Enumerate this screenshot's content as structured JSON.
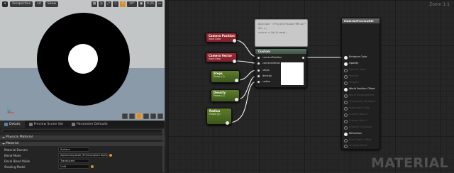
{
  "viewport": {
    "toolbar": {
      "menu_icon": "chevron-down-icon",
      "perspective_label": "Perspective",
      "lit_label": "Lit",
      "show_label": "Show",
      "right_buttons": [
        "▦",
        "◎",
        "⤢",
        "◇",
        "8",
        "10°",
        "▣",
        "0.25",
        "▭"
      ]
    },
    "preview_icons": [
      "cylinder-icon",
      "sphere-icon",
      "plane-icon",
      "cube-icon",
      "mesh-icon",
      "teapot-icon"
    ]
  },
  "details": {
    "tabs": [
      {
        "label": "Details",
        "active": true
      },
      {
        "label": "Preview Scene Set",
        "active": false
      },
      {
        "label": "Parameter Defaults",
        "active": false
      }
    ],
    "sections": {
      "physical": "Physical Material",
      "material": "Material"
    },
    "props": [
      {
        "label": "Material Domain",
        "value": "Surface"
      },
      {
        "label": "Blend Mode",
        "value": "AlphaComposite (Premultiplied Alpha)"
      },
      {
        "label": "Decal Blend Mode",
        "value": "Translucent"
      },
      {
        "label": "Shading Model",
        "value": "Unlit"
      }
    ]
  },
  "graph": {
    "zoom_label": "Zoom 1:1",
    "watermark": "MATERIAL",
    "nodes": {
      "camera_position": {
        "title": "Camera Position",
        "sub": "Input Data"
      },
      "camera_vector": {
        "title": "Camera Vector",
        "sub": "Input Data"
      },
      "steps": {
        "title": "Steps",
        "sub": "Param (1)"
      },
      "density": {
        "title": "Density",
        "sub": "Param (1)"
      },
      "radius": {
        "title": "Radius",
        "sub": "Param (0)"
      }
    },
    "code": [
      "#include \"/Project/Viewer/RM.usf\"",
      "",
      "Vol v;",
      "",
      "return v.Vol(trace);"
    ],
    "custom": {
      "title": "Custom",
      "inputs": [
        "cameraPosition",
        "cameraVector",
        "steps",
        "density",
        "radius"
      ]
    },
    "result": {
      "title": "MaterialPreviewRM",
      "pins": [
        {
          "label": "Emissive Color",
          "on": true
        },
        {
          "label": "Opacity",
          "on": true
        },
        {
          "label": "Opacity Mask",
          "on": false
        },
        {
          "label": "Normal",
          "on": false
        },
        {
          "label": "Tangent",
          "on": false
        },
        {
          "label": "World Position Offset",
          "on": true
        },
        {
          "label": "World Displacement",
          "on": false
        },
        {
          "label": "Tessellation Multiplier",
          "on": false
        },
        {
          "label": "Subsurface Color",
          "on": false
        },
        {
          "label": "Custom Data 0",
          "on": false
        },
        {
          "label": "Custom Data 1",
          "on": false
        },
        {
          "label": "Ambient Occlusion",
          "on": false
        },
        {
          "label": "Refraction",
          "on": true
        },
        {
          "label": "Pixel Depth Offset",
          "on": false
        },
        {
          "label": "Shading Model",
          "on": false
        }
      ]
    }
  }
}
